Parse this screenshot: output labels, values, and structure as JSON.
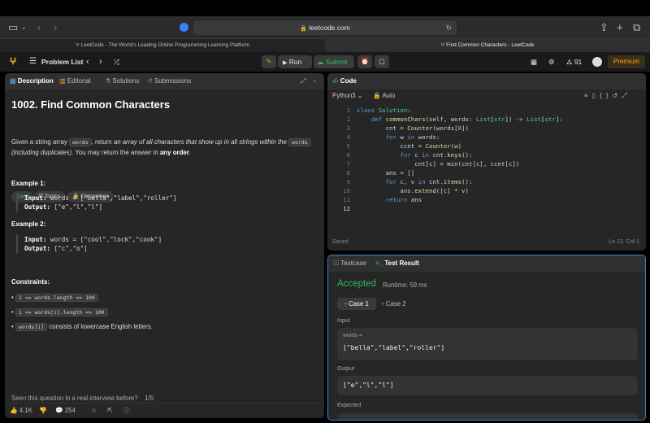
{
  "browser": {
    "address": "leetcode.com",
    "tabs": [
      "LeetCode - The World's Leading Online Programming Learning Platform",
      "Find Common Characters - LeetCode"
    ]
  },
  "topbar": {
    "problem_list": "Problem List",
    "run": "Run",
    "submit": "Submit",
    "streak": "91",
    "premium": "Premium"
  },
  "left": {
    "tabs": [
      "Description",
      "Editorial",
      "Solutions",
      "Submissions"
    ],
    "title": "1002. Find Common Characters",
    "difficulty": "Easy",
    "topics": "Topics",
    "companies": "Companies",
    "desc": {
      "p1": "Given a string array ",
      "code1": "words",
      "p2": ", return ",
      "em1": "an array of all characters that show up in all strings within the ",
      "code2": "words",
      "em2": "(including duplicates).",
      "p3": " You may return the answer in ",
      "bold": "any order",
      "p4": "."
    },
    "ex1": {
      "title": "Example 1:",
      "input_label": "Input:",
      "input": "words = [\"bella\",\"label\",\"roller\"]",
      "output_label": "Output:",
      "output": "[\"e\",\"l\",\"l\"]"
    },
    "ex2": {
      "title": "Example 2:",
      "input_label": "Input:",
      "input": "words = [\"cool\",\"lock\",\"cook\"]",
      "output_label": "Output:",
      "output": "[\"c\",\"o\"]"
    },
    "constraints_title": "Constraints:",
    "c1": "1 <= words.length <= 100",
    "c2": "1 <= words[i].length <= 100",
    "c3code": "words[i]",
    "c3": " consists of lowercase English letters.",
    "seen": "Seen this question in a real interview before?",
    "seen_page": "1/5",
    "likes": "4.1K",
    "comments": "254"
  },
  "code": {
    "title": "Code",
    "lang": "Python3",
    "auto": "Auto",
    "saved": "Saved",
    "pos": "Ln 12, Col 1"
  },
  "test": {
    "tab1": "Testcase",
    "tab2": "Test Result",
    "status": "Accepted",
    "runtime": "Runtime: 59 ms",
    "case1": "Case 1",
    "case2": "Case 2",
    "input_label": "Input",
    "var": "words =",
    "input_val": "[\"bella\",\"label\",\"roller\"]",
    "output_label": "Output",
    "output_val": "[\"e\",\"l\",\"l\"]",
    "expected_label": "Expected"
  }
}
